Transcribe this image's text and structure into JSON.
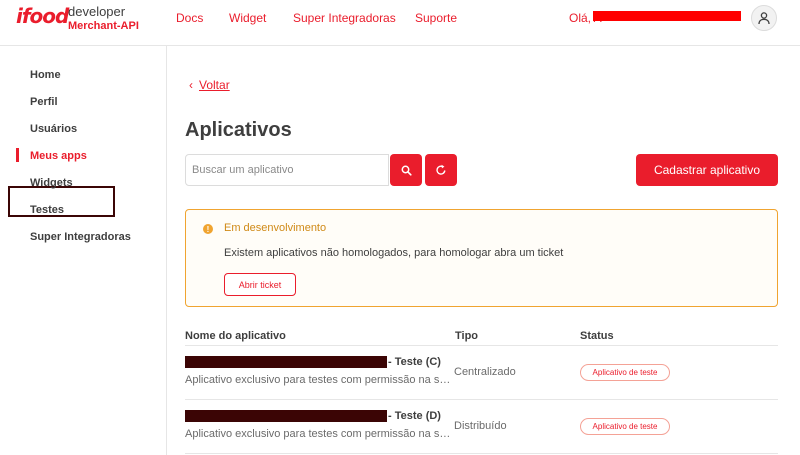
{
  "header": {
    "logo_text": "ifood",
    "brand_primary": "developer",
    "brand_secondary": "Merchant-API",
    "nav": [
      "Docs",
      "Widget",
      "Super Integradoras",
      "Suporte"
    ],
    "greeting": "Olá, A",
    "avatar_icon": "user-icon"
  },
  "sidebar": {
    "items": [
      {
        "label": "Home"
      },
      {
        "label": "Perfil"
      },
      {
        "label": "Usuários"
      },
      {
        "label": "Meus apps"
      },
      {
        "label": "Widgets"
      },
      {
        "label": "Testes"
      },
      {
        "label": "Super Integradoras"
      }
    ],
    "active": "Meus apps"
  },
  "main": {
    "back_label": "Voltar",
    "title": "Aplicativos",
    "search_placeholder": "Buscar um aplicativo",
    "register_button": "Cadastrar aplicativo",
    "alert": {
      "title": "Em desenvolvimento",
      "text": "Existem aplicativos não homologados, para homologar abra um ticket",
      "button": "Abrir ticket"
    },
    "table": {
      "columns": [
        "Nome do aplicativo",
        "Tipo",
        "Status"
      ],
      "rows": [
        {
          "name_suffix": "- Teste (C)",
          "description": "Aplicativo exclusivo para testes com permissão na su...",
          "type": "Centralizado",
          "status": "Aplicativo de teste"
        },
        {
          "name_suffix": "- Teste (D)",
          "description": "Aplicativo exclusivo para testes com permissão na su...",
          "type": "Distribuído",
          "status": "Aplicativo de teste"
        }
      ]
    }
  },
  "colors": {
    "brand_red": "#ea1d2c",
    "warning": "#f0a430",
    "text": "#3e3e3e"
  }
}
